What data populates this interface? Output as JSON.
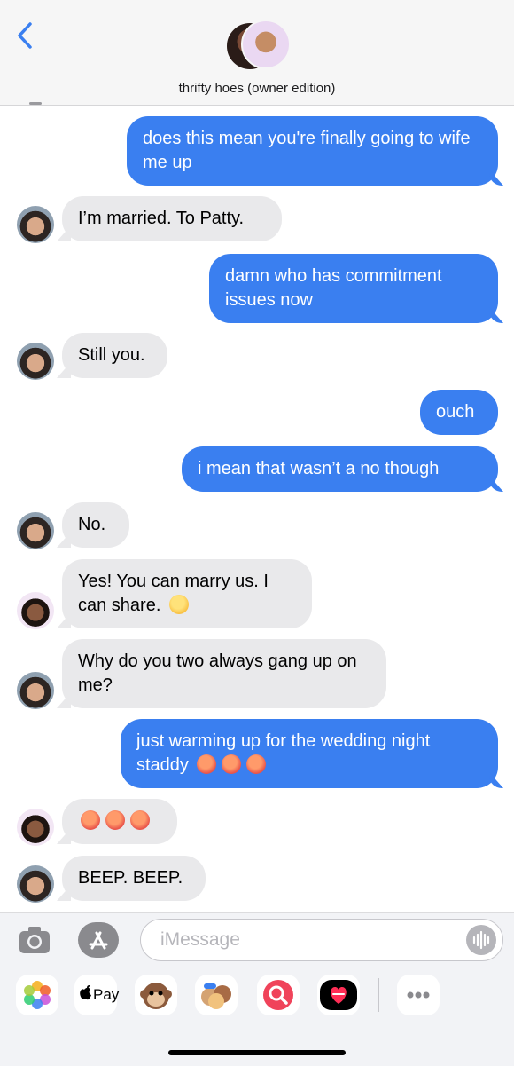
{
  "header": {
    "title": "thrifty hoes (owner edition)"
  },
  "messages": [
    {
      "text": "does this mean you're finally going to wife me up"
    },
    {
      "text": "I’m married. To Patty."
    },
    {
      "text": "damn who has commitment issues now"
    },
    {
      "text": "Still you."
    },
    {
      "text": "ouch"
    },
    {
      "text": "i mean that wasn’t a no though"
    },
    {
      "text": "No."
    },
    {
      "text": "Yes! You can marry us. I can share."
    },
    {
      "text": "Why do you two always gang up on me?"
    },
    {
      "text": "just warming up for the wedding night staddy"
    },
    {
      "text": ""
    },
    {
      "text": "BEEP. BEEP."
    }
  ],
  "composer": {
    "placeholder": "iMessage"
  },
  "apps": {
    "applepay_label": "Pay"
  },
  "colors": {
    "outgoing": "#3a7ff0",
    "incoming": "#e9e9eb",
    "header_bg": "#f6f6f6"
  },
  "icons": [
    "back-chevron-icon",
    "camera-icon",
    "app-store-icon",
    "audio-waveform-icon",
    "photos-icon",
    "apple-pay-icon",
    "monkey-emoji-icon",
    "memoji-icon",
    "image-search-icon",
    "digital-touch-icon",
    "more-apps-icon"
  ]
}
